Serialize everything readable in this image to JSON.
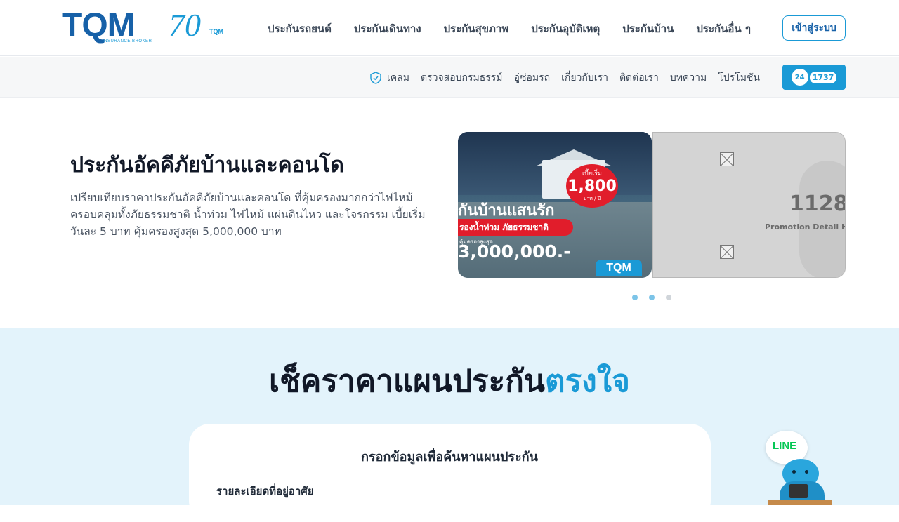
{
  "header": {
    "logo_text": "TQM",
    "logo_subtext": "INSURANCE BROKER",
    "anniversary_number": "70",
    "anniversary_brand": "TQM",
    "nav": [
      {
        "label": "ประกันรถยนต์"
      },
      {
        "label": "ประกันเดินทาง"
      },
      {
        "label": "ประกันสุขภาพ"
      },
      {
        "label": "ประกันอุบัติเหตุ"
      },
      {
        "label": "ประกันบ้าน"
      },
      {
        "label": "ประกันอื่น ๆ"
      }
    ],
    "login_label": "เข้าสู่ระบบ"
  },
  "subnav": {
    "items": [
      {
        "label": "เคลม"
      },
      {
        "label": "ตรวจสอบกรมธรรม์"
      },
      {
        "label": "อู่ซ่อมรถ"
      },
      {
        "label": "เกี่ยวกับเรา"
      },
      {
        "label": "ติดต่อเรา"
      },
      {
        "label": "บทความ"
      },
      {
        "label": "โปรโมชัน"
      }
    ],
    "hotline_24": "24",
    "hotline_number": "1737"
  },
  "hero": {
    "title": "ประกันอัคคีภัยบ้านและคอนโด",
    "description": "เปรียบเทียบราคาประกันอัคคีภัยบ้านและคอนโด ที่คุ้มครองมากกว่าไฟไหม้ ครอบคลุมทั้งภัยธรรมชาติ น้ำท่วม ไฟไหม้ แผ่นดินไหว และโจรกรรม เบี้ยเริ่มวันละ 5 บาท คุ้มครองสูงสุด 5,000,000 บาท"
  },
  "carousel": {
    "slide1": {
      "headline": "กันบ้านแสนรัก",
      "redbar": "รองน้ำท่วม ภัยธรรมชาติ",
      "coverage_small": "คุ้มครองสูงสุด",
      "coverage_big": "3,000,000.-",
      "badge_top": "เบี้ยเริ่ม",
      "badge_price": "1,800",
      "badge_unit": "บาท / ปี",
      "brand": "TQM"
    },
    "slide2": {
      "number": "1128",
      "text": "Promotion Detail High"
    },
    "dots": [
      {
        "active": true,
        "color": "#7cc4e8"
      },
      {
        "active": false,
        "color": "#7cc4e8"
      },
      {
        "active": false,
        "color": "#d0d5da"
      }
    ]
  },
  "compare": {
    "title_main": "เช็คราคาแผนประกัน",
    "title_highlight": "ตรงใจ",
    "card_title": "กรอกข้อมูลเพื่อค้นหาแผนประกัน",
    "field_label": "รายละเอียดที่อยู่อาศัย"
  },
  "line_widget": {
    "text": "LINE"
  },
  "colors": {
    "brand_blue": "#1761a8",
    "accent_blue": "#1a9ad6",
    "line_green": "#06c755",
    "promo_red": "#e11d2b",
    "section_bg": "#e3f3fb"
  }
}
